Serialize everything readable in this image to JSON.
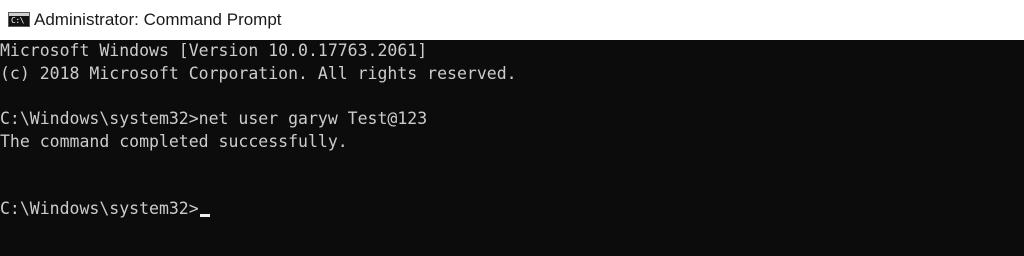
{
  "window": {
    "title": "Administrator: Command Prompt",
    "icon": "cmd-icon",
    "icon_glyph": "C:\\"
  },
  "console": {
    "lines": [
      "Microsoft Windows [Version 10.0.17763.2061]",
      "(c) 2018 Microsoft Corporation. All rights reserved.",
      "C:\\Windows\\system32>net user garyw Test@123",
      "The command completed successfully.",
      "C:\\Windows\\system32>"
    ],
    "background_color": "#0c0c0c",
    "text_color": "#cccccc"
  }
}
